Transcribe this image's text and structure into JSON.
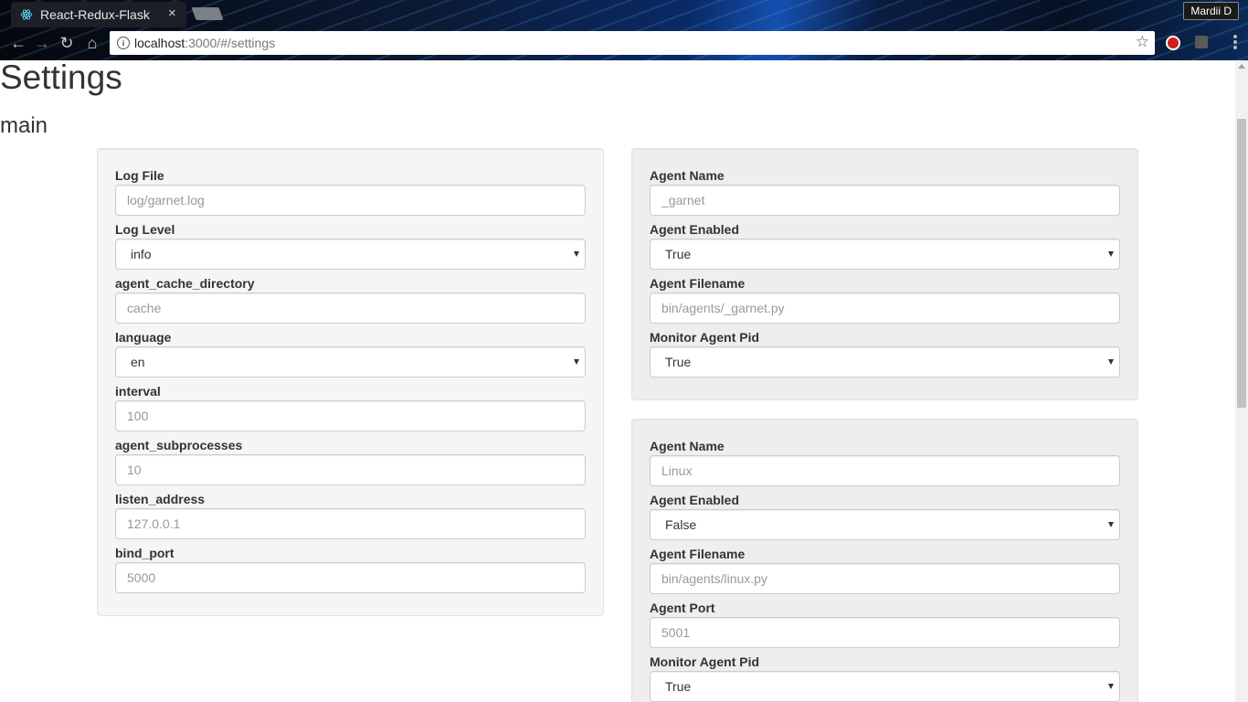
{
  "browser": {
    "tab_title": "React-Redux-Flask",
    "tab_close": "×",
    "profile_name": "Mardii D",
    "url_host": "localhost",
    "url_path": ":3000/#/settings"
  },
  "page": {
    "title": "Settings",
    "section": "main"
  },
  "main_settings": {
    "log_file": {
      "label": "Log File",
      "placeholder": "log/garnet.log"
    },
    "log_level": {
      "label": "Log Level",
      "value": "info"
    },
    "agent_cache_directory": {
      "label": "agent_cache_directory",
      "placeholder": "cache"
    },
    "language": {
      "label": "language",
      "value": "en"
    },
    "interval": {
      "label": "interval",
      "placeholder": "100"
    },
    "agent_subprocesses": {
      "label": "agent_subprocesses",
      "placeholder": "10"
    },
    "listen_address": {
      "label": "listen_address",
      "placeholder": "127.0.0.1"
    },
    "bind_port": {
      "label": "bind_port",
      "placeholder": "5000"
    }
  },
  "agent1": {
    "agent_name": {
      "label": "Agent Name",
      "placeholder": "_garnet"
    },
    "agent_enabled": {
      "label": "Agent Enabled",
      "value": "True"
    },
    "agent_filename": {
      "label": "Agent Filename",
      "placeholder": "bin/agents/_garnet.py"
    },
    "monitor_agent_pid": {
      "label": "Monitor Agent Pid",
      "value": "True"
    }
  },
  "agent2": {
    "agent_name": {
      "label": "Agent Name",
      "placeholder": "Linux"
    },
    "agent_enabled": {
      "label": "Agent Enabled",
      "value": "False"
    },
    "agent_filename": {
      "label": "Agent Filename",
      "placeholder": "bin/agents/linux.py"
    },
    "agent_port": {
      "label": "Agent Port",
      "placeholder": "5001"
    },
    "monitor_agent_pid": {
      "label": "Monitor Agent Pid",
      "value": "True"
    }
  },
  "colors": {
    "well_bg": "#f5f5f5",
    "input_border": "#cccccc",
    "text": "#333333"
  }
}
